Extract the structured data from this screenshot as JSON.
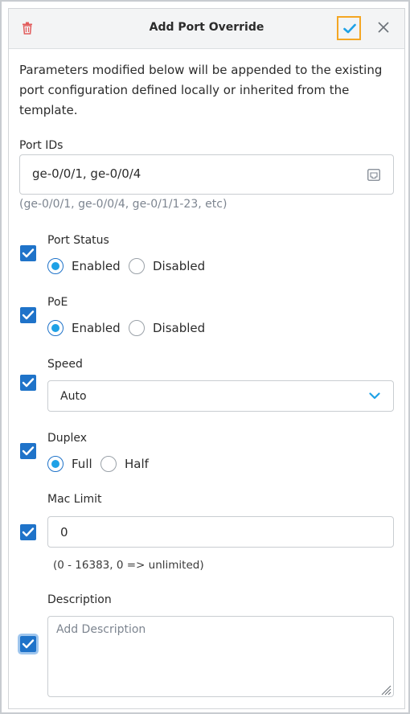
{
  "header": {
    "title": "Add Port Override",
    "icons": {
      "delete": "trash-icon",
      "confirm": "check-icon",
      "close": "close-icon"
    }
  },
  "intro_text": "Parameters modified below will be appended to the existing port configuration defined locally or inherited from the template.",
  "port_ids": {
    "label": "Port IDs",
    "value": "ge-0/0/1, ge-0/0/4",
    "hint": "(ge-0/0/1, ge-0/0/4, ge-0/1/1-23, etc)"
  },
  "port_status": {
    "label": "Port Status",
    "options": [
      "Enabled",
      "Disabled"
    ],
    "selected": "Enabled",
    "checked": true
  },
  "poe": {
    "label": "PoE",
    "options": [
      "Enabled",
      "Disabled"
    ],
    "selected": "Enabled",
    "checked": true
  },
  "speed": {
    "label": "Speed",
    "value": "Auto",
    "checked": true
  },
  "duplex": {
    "label": "Duplex",
    "options": [
      "Full",
      "Half"
    ],
    "selected": "Full",
    "checked": true
  },
  "mac_limit": {
    "label": "Mac Limit",
    "value": "0",
    "hint": "(0 - 16383, 0 => unlimited)",
    "checked": true
  },
  "description": {
    "label": "Description",
    "placeholder": "Add Description",
    "checked": true
  },
  "colors": {
    "accent_blue": "#1f73c9",
    "radio_fill": "#1ea1e6",
    "confirm_border": "#f4a623",
    "trash_red": "#e25c5c"
  }
}
